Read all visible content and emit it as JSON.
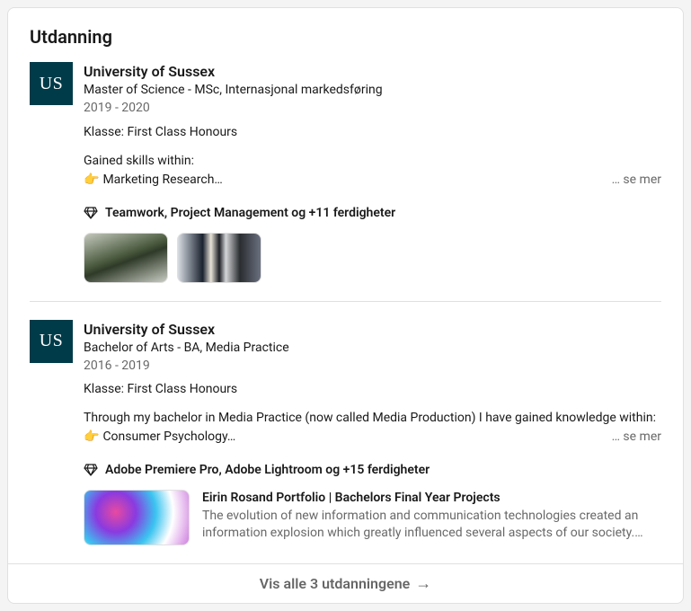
{
  "section_title": "Utdanning",
  "see_more_label": "… se mer",
  "footer_link": "Vis alle 3 utdanningene",
  "items": [
    {
      "logo_text": "US",
      "school": "University of Sussex",
      "degree": "Master of Science - MSc, Internasjonal markedsføring",
      "dates": "2019 - 2020",
      "klasse": "Klasse: First Class Honours",
      "desc_line1": "Gained skills within:",
      "desc_emoji": "👉",
      "desc_line2": "Marketing Research…",
      "skills": "Teamwork, Project Management og +11 ferdigheter"
    },
    {
      "logo_text": "US",
      "school": "University of Sussex",
      "degree": "Bachelor of Arts - BA, Media Practice",
      "dates": "2016 - 2019",
      "klasse": "Klasse: First Class Honours",
      "desc_line1": "Through my bachelor in Media Practice (now called Media Production) I have gained knowledge within:",
      "desc_emoji": "👉",
      "desc_line2": "Consumer Psychology…",
      "skills": "Adobe Premiere Pro, Adobe Lightroom og +15 ferdigheter",
      "media_title": "Eirin Rosand Portfolio | Bachelors Final Year Projects",
      "media_desc": "The evolution of new information and communication technologies created an information explosion which greatly influenced several aspects of our society. With this development…"
    }
  ]
}
